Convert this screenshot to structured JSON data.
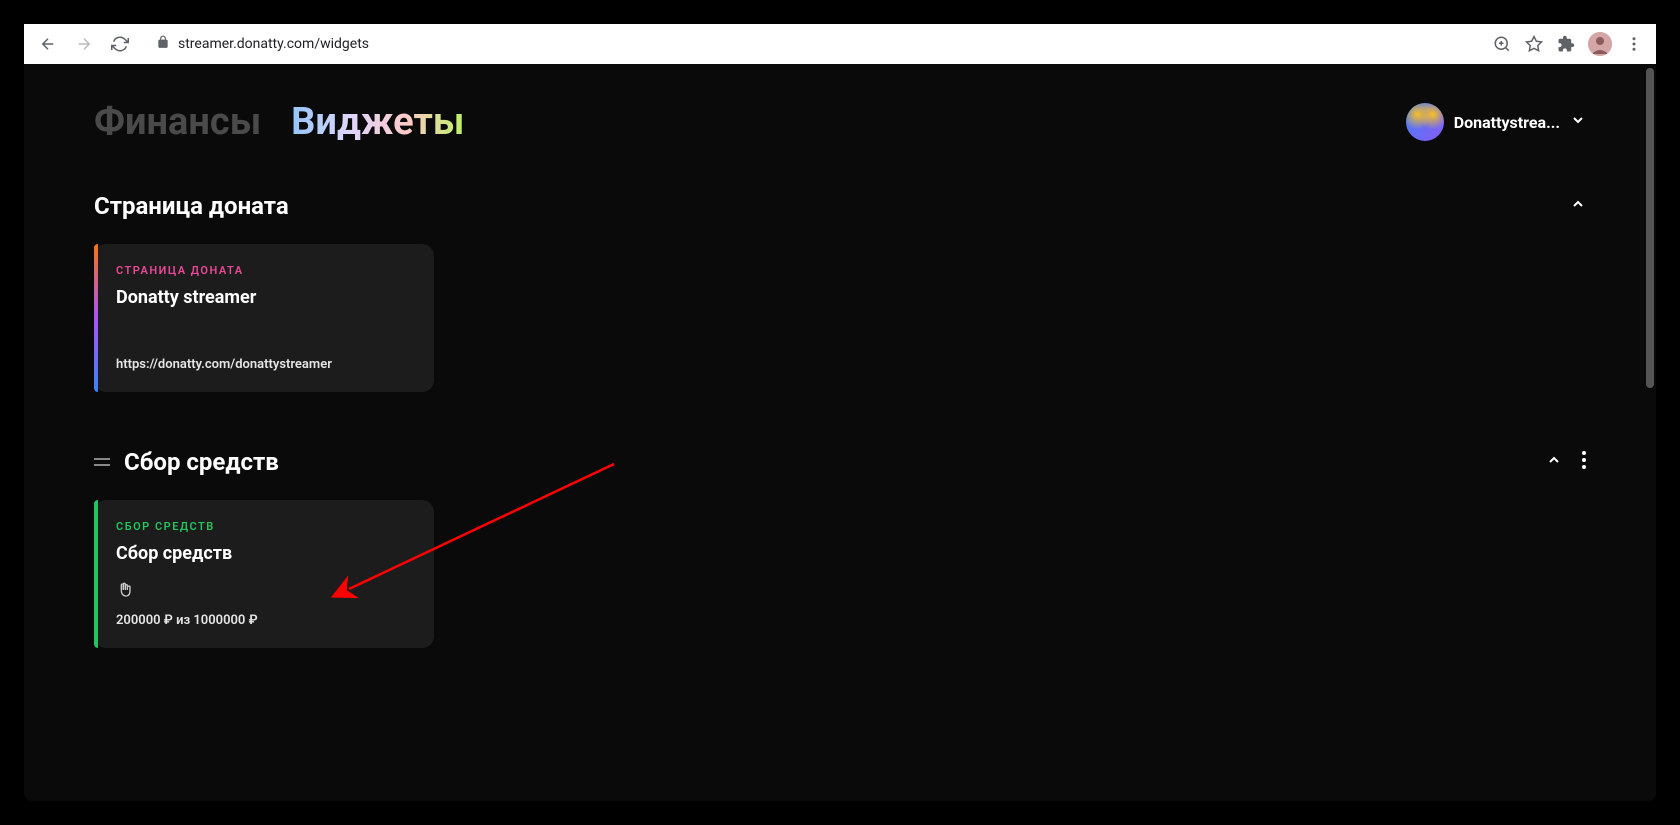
{
  "browser": {
    "url": "streamer.donatty.com/widgets"
  },
  "header": {
    "tabs": {
      "finances": "Финансы",
      "widgets": "Виджеты"
    },
    "user_name": "Donattystrea..."
  },
  "sections": {
    "donate": {
      "title": "Страница доната",
      "card": {
        "label": "СТРАНИЦА ДОНАТА",
        "title": "Donatty streamer",
        "url": "https://donatty.com/donattystreamer"
      }
    },
    "fundraiser": {
      "title": "Сбор средств",
      "card": {
        "label": "СБОР СРЕДСТВ",
        "title": "Сбор средств",
        "progress": "200000 ₽ из 1000000 ₽"
      }
    }
  }
}
